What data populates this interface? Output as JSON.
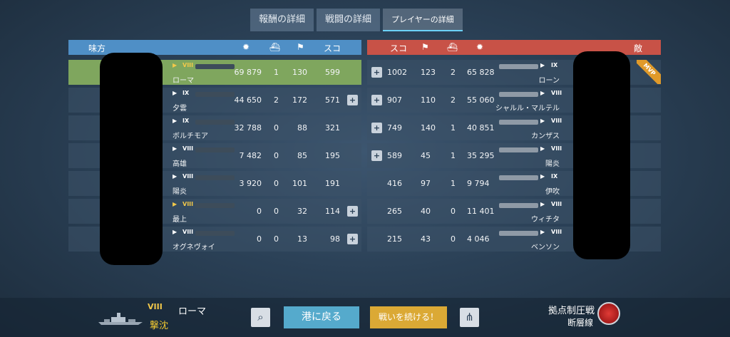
{
  "tabs": [
    {
      "label": "報酬の詳細",
      "active": false
    },
    {
      "label": "戦闘の詳細",
      "active": false
    },
    {
      "label": "プレイヤーの詳細",
      "active": true
    }
  ],
  "left": {
    "title": "味方",
    "icons": [
      "damage-icon",
      "kills-icon",
      "xp-icon"
    ],
    "score_label": "スコ",
    "rows": [
      {
        "tier": "VIII",
        "ship": "ローマ",
        "damage": "69 879",
        "kills": "1",
        "xp": "130",
        "score": "599",
        "highlight": true,
        "add_friend": false,
        "gold": true
      },
      {
        "tier": "IX",
        "ship": "夕雲",
        "damage": "44 650",
        "kills": "2",
        "xp": "172",
        "score": "571",
        "highlight": false,
        "add_friend": true,
        "gold": false
      },
      {
        "tier": "IX",
        "ship": "ボルチモア",
        "damage": "32 788",
        "kills": "0",
        "xp": "88",
        "score": "321",
        "highlight": false,
        "add_friend": false,
        "gold": false
      },
      {
        "tier": "VIII",
        "ship": "高雄",
        "damage": "7 482",
        "kills": "0",
        "xp": "85",
        "score": "195",
        "highlight": false,
        "add_friend": false,
        "gold": false
      },
      {
        "tier": "VIII",
        "ship": "陽炎",
        "damage": "3 920",
        "kills": "0",
        "xp": "101",
        "score": "191",
        "highlight": false,
        "add_friend": false,
        "gold": false
      },
      {
        "tier": "VIII",
        "ship": "最上",
        "damage": "0",
        "kills": "0",
        "xp": "32",
        "score": "114",
        "highlight": false,
        "add_friend": true,
        "gold": true
      },
      {
        "tier": "VIII",
        "ship": "オグネヴォイ",
        "damage": "0",
        "kills": "0",
        "xp": "13",
        "score": "98",
        "highlight": false,
        "add_friend": true,
        "gold": false
      }
    ]
  },
  "right": {
    "title": "敵",
    "score_label": "スコ",
    "mvp_label": "MVP",
    "rows": [
      {
        "tier": "IX",
        "ship": "ローン",
        "damage": "65 828",
        "kills": "2",
        "xp": "123",
        "score": "1002",
        "add_friend": true,
        "mvp": true
      },
      {
        "tier": "VIII",
        "ship": "シャルル・マルテル",
        "damage": "55 060",
        "kills": "2",
        "xp": "110",
        "score": "907",
        "add_friend": true,
        "mvp": false
      },
      {
        "tier": "VIII",
        "ship": "カンザス",
        "damage": "40 851",
        "kills": "1",
        "xp": "140",
        "score": "749",
        "add_friend": true,
        "mvp": false
      },
      {
        "tier": "VIII",
        "ship": "陽炎",
        "damage": "35 295",
        "kills": "1",
        "xp": "45",
        "score": "589",
        "add_friend": true,
        "mvp": false
      },
      {
        "tier": "IX",
        "ship": "伊吹",
        "damage": "9 794",
        "kills": "1",
        "xp": "97",
        "score": "416",
        "add_friend": false,
        "mvp": false
      },
      {
        "tier": "VIII",
        "ship": "ウィチタ",
        "damage": "11 401",
        "kills": "0",
        "xp": "40",
        "score": "265",
        "add_friend": false,
        "mvp": false
      },
      {
        "tier": "VIII",
        "ship": "ベンソン",
        "damage": "4 046",
        "kills": "0",
        "xp": "43",
        "score": "215",
        "add_friend": false,
        "mvp": false
      }
    ]
  },
  "footer": {
    "tier": "VIII",
    "ship_name": "ローマ",
    "status": "撃沈",
    "port_button": "港に戻る",
    "continue_button": "戦いを続ける！",
    "mode": "拠点制圧戦",
    "map": "断層線"
  },
  "colors": {
    "ally": "#4f8fc6",
    "enemy": "#c85247",
    "highlight": "#7fa65e",
    "mvp": "#e09a2a",
    "port": "#55aacc",
    "continue": "#dba935"
  }
}
